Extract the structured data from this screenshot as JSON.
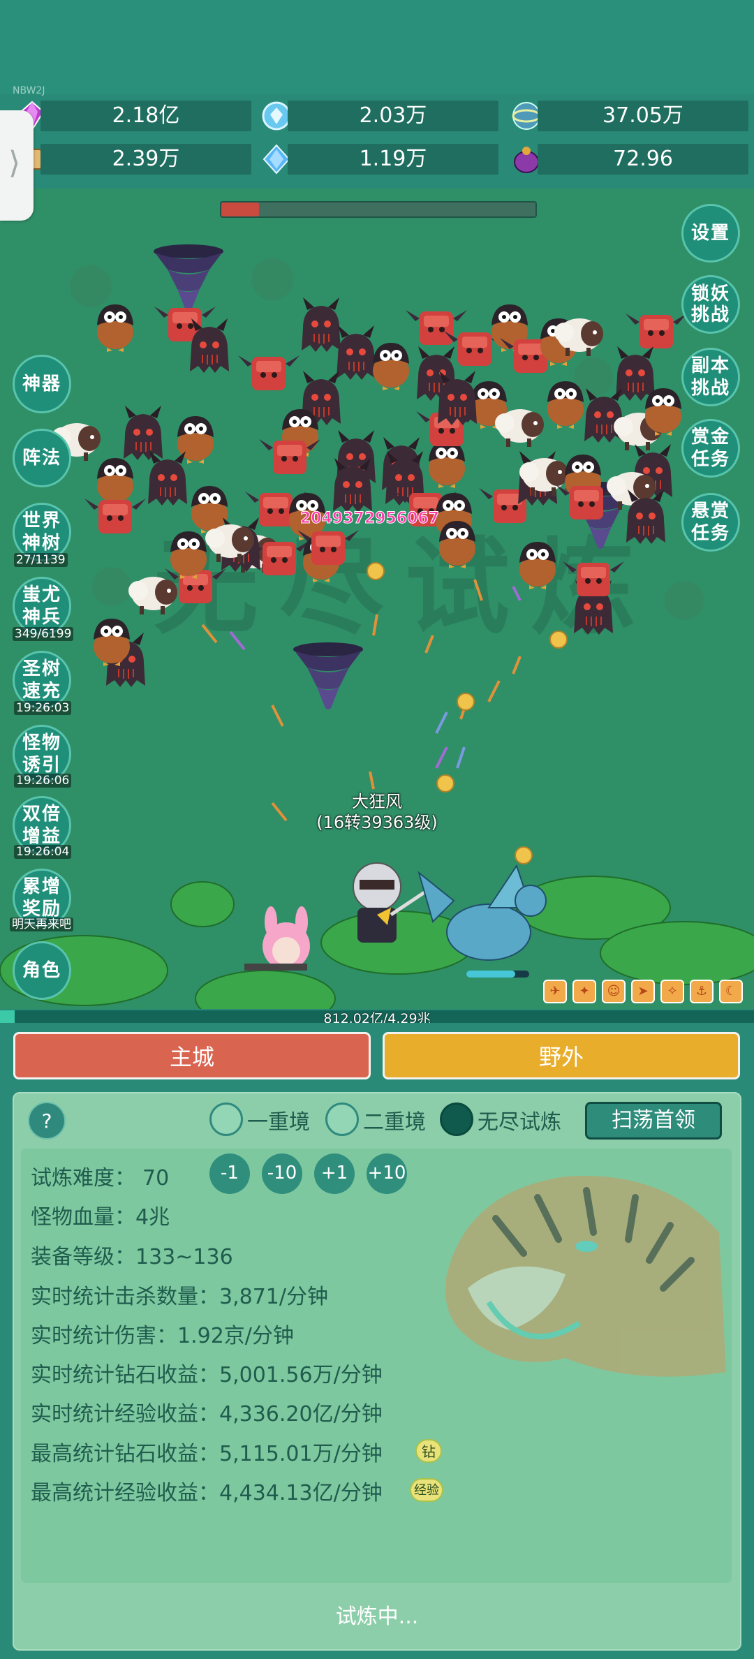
{
  "header": {
    "tag": "NBW2J"
  },
  "resources": [
    {
      "icon": "purple-gem-icon",
      "value": "2.18亿"
    },
    {
      "icon": "blue-diamond-icon",
      "value": "2.03万"
    },
    {
      "icon": "globe-orb-icon",
      "value": "37.05万"
    },
    {
      "icon": "scroll-icon",
      "value": "2.39万"
    },
    {
      "icon": "blue-crystal-icon",
      "value": "1.19万"
    },
    {
      "icon": "purple-pouch-icon",
      "value": "72.96"
    }
  ],
  "wave_progress": 0.12,
  "right_buttons": [
    {
      "label": "设置"
    },
    {
      "label": "锁妖挑战"
    },
    {
      "label": "副本挑战"
    },
    {
      "label": "赏金任务"
    },
    {
      "label": "悬赏任务"
    }
  ],
  "left_buttons": [
    {
      "label": "神器",
      "sub": ""
    },
    {
      "label": "阵法",
      "sub": ""
    },
    {
      "label": "世界神树",
      "sub": "27/1139"
    },
    {
      "label": "蚩尤神兵",
      "sub": "349/6199"
    },
    {
      "label": "圣树速充",
      "sub": "19:26:03"
    },
    {
      "label": "怪物诱引",
      "sub": "19:26:06"
    },
    {
      "label": "双倍增益",
      "sub": "19:26:04"
    },
    {
      "label": "累增奖励",
      "sub": "明天再来吧"
    },
    {
      "label": "角色",
      "sub": ""
    }
  ],
  "battle": {
    "damage_number": "2049372956067",
    "player_name": "大狂风",
    "player_level": "(16转39363级)",
    "exp_text": "812.02亿/4.29兆",
    "exp_progress": 0.019
  },
  "tabs": {
    "main": "主城",
    "wild": "野外"
  },
  "panel": {
    "help": "?",
    "modes": [
      "一重境",
      "二重境",
      "无尽试炼"
    ],
    "selected_mode": 2,
    "sweep": "扫荡首领",
    "difficulty_label": "试炼难度：",
    "difficulty_value": "70",
    "adjust": [
      "-1",
      "-10",
      "+1",
      "+10"
    ],
    "stats": [
      "怪物血量：4兆",
      "装备等级：133~136",
      "实时统计击杀数量：3,871/分钟",
      "实时统计伤害：1.92京/分钟",
      "实时统计钻石收益：5,001.56万/分钟",
      "实时统计经验收益：4,336.20亿/分钟",
      "最高统计钻石收益：5,115.01万/分钟",
      "最高统计经验收益：4,434.13亿/分钟"
    ],
    "badge_diamond": "钻",
    "badge_exp": "经验",
    "status": "试炼中..."
  },
  "colors": {
    "main_tab": "#d96450",
    "wild_tab": "#e8ad2a",
    "panel": "#8dceaa",
    "accent": "#2f8e7c"
  }
}
